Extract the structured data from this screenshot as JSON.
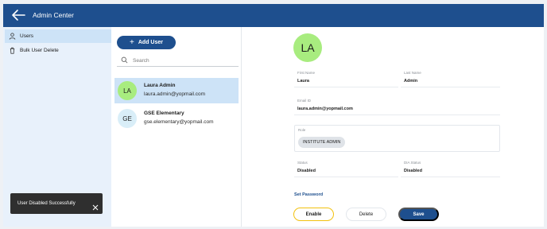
{
  "header": {
    "title": "Admin Center",
    "back_icon": "arrow-left-icon"
  },
  "sidebar": {
    "items": [
      {
        "label": "Users",
        "icon": "user-icon",
        "active": true
      },
      {
        "label": "Bulk User Delete",
        "icon": "trash-icon",
        "active": false
      }
    ]
  },
  "user_list": {
    "add_label": "Add User",
    "search_placeholder": "Search",
    "users": [
      {
        "initials": "LA",
        "name": "Laura Admin",
        "email": "laura.admin@yopmail.com",
        "avatar_color": "#a8ec7f",
        "selected": true
      },
      {
        "initials": "GE",
        "name": "GSE Elementary",
        "email": "gse.elementary@yopmail.com",
        "avatar_color": "#d9eef8",
        "selected": false
      }
    ]
  },
  "detail": {
    "initials": "LA",
    "first_name_label": "First Name",
    "first_name": "Laura",
    "last_name_label": "Last Name",
    "last_name": "Admin",
    "email_label": "Email ID",
    "email": "laura.admin@yopmail.com",
    "role_label": "Role",
    "role": "INSTITUTE ADMIN",
    "status_label": "Status",
    "status": "Disabled",
    "dia_status_label": "DIA Status",
    "dia_status": "Disabled",
    "set_password_label": "Set Password",
    "enable_label": "Enable",
    "delete_label": "Delete",
    "save_label": "Save"
  },
  "toast": {
    "message": "User Disabled Successfully",
    "close_icon": "close-icon"
  },
  "colors": {
    "primary": "#1e4f8e",
    "accent": "#f2c10e",
    "sidebar_bg": "#e8f1fb",
    "selected_bg": "#cde3f7"
  }
}
